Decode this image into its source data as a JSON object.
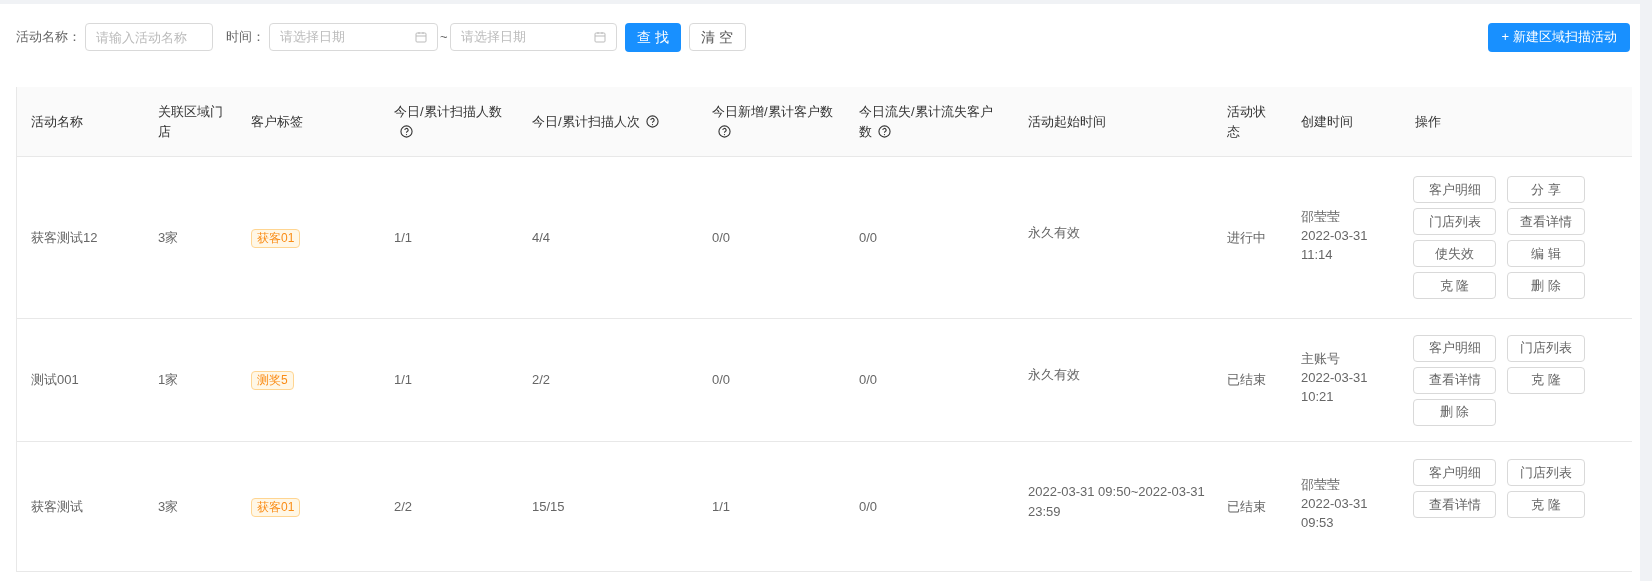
{
  "filters": {
    "name_label": "活动名称：",
    "name_placeholder": "请输入活动名称",
    "time_label": "时间：",
    "start_placeholder": "请选择日期",
    "separator": "~",
    "end_placeholder": "请选择日期",
    "search_button": "查 找",
    "clear_button": "清 空"
  },
  "create_button": "+ 新建区域扫描活动",
  "table": {
    "columns": [
      {
        "label": "活动名称",
        "help": false
      },
      {
        "label": "关联区域门店",
        "help": false
      },
      {
        "label": "客户标签",
        "help": false
      },
      {
        "label": "今日/累计扫描人数",
        "help": true
      },
      {
        "label": "今日/累计扫描人次",
        "help": true
      },
      {
        "label": "今日新增/累计客户数",
        "help": true
      },
      {
        "label": "今日流失/累计流失客户数",
        "help": true
      },
      {
        "label": "活动起始时间",
        "help": false
      },
      {
        "label": "活动状态",
        "help": false
      },
      {
        "label": "创建时间",
        "help": false
      },
      {
        "label": "操作",
        "help": false
      }
    ],
    "rows": [
      {
        "name": "获客测试12",
        "stores": "3家",
        "tag": "获客01",
        "scan_people": "1/1",
        "scan_times": "4/4",
        "new_customers": "0/0",
        "lost_customers": "0/0",
        "period": "永久有效",
        "status": "进行中",
        "creator": "邵莹莹",
        "created_date": "2022-03-31",
        "created_time": "11:14",
        "actions": [
          "客户明细",
          "分 享",
          "门店列表",
          "查看详情",
          "使失效",
          "编 辑",
          "克 隆",
          "删 除"
        ]
      },
      {
        "name": "测试001",
        "stores": "1家",
        "tag": "测奖5",
        "scan_people": "1/1",
        "scan_times": "2/2",
        "new_customers": "0/0",
        "lost_customers": "0/0",
        "period": "永久有效",
        "status": "已结束",
        "creator": "主账号",
        "created_date": "2022-03-31",
        "created_time": "10:21",
        "actions": [
          "客户明细",
          "门店列表",
          "查看详情",
          "克 隆",
          "删 除"
        ]
      },
      {
        "name": "获客测试",
        "stores": "3家",
        "tag": "获客01",
        "scan_people": "2/2",
        "scan_times": "15/15",
        "new_customers": "1/1",
        "lost_customers": "0/0",
        "period": "2022-03-31 09:50~2022-03-31 23:59",
        "status": "已结束",
        "creator": "邵莹莹",
        "created_date": "2022-03-31",
        "created_time": "09:53",
        "actions": [
          "客户明细",
          "门店列表",
          "查看详情",
          "克 隆"
        ]
      }
    ]
  }
}
